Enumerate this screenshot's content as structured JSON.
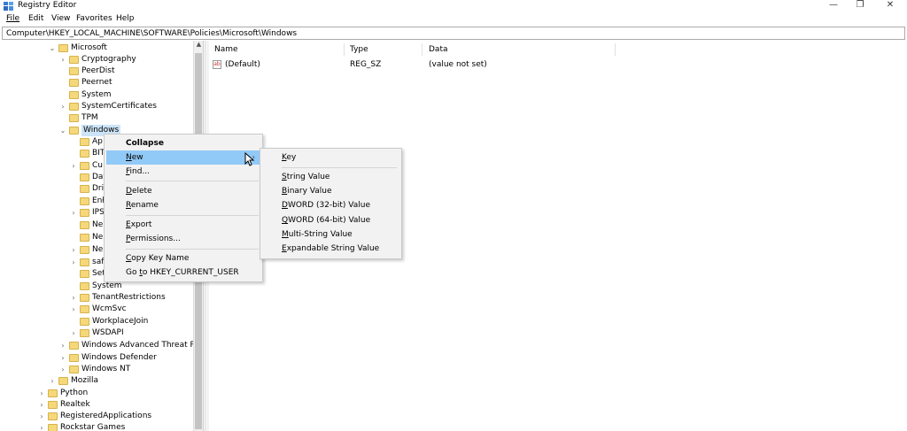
{
  "window": {
    "title": "Registry Editor",
    "minimize": "—",
    "restore": "❐",
    "close": "✕"
  },
  "menu": {
    "file": "File",
    "edit": "Edit",
    "view": "View",
    "favorites": "Favorites",
    "help": "Help"
  },
  "address": "Computer\\HKEY_LOCAL_MACHINE\\SOFTWARE\\Policies\\Microsoft\\Windows",
  "tree": {
    "microsoft": "Microsoft",
    "cryptography": "Cryptography",
    "peerdist": "PeerDist",
    "peernet": "Peernet",
    "system": "System",
    "systemcertificates": "SystemCertificates",
    "tpm": "TPM",
    "windows": "Windows",
    "ap": "Ap",
    "bit": "BIT",
    "cu": "Cu",
    "dat": "Dat",
    "dri": "Dri",
    "enh": "Enł",
    "ips": "IPS",
    "ne1": "Ne",
    "ne2": "Ne",
    "ne3": "Ne",
    "saf": "saf",
    "set": "Set",
    "system2": "System",
    "tenantrestrictions": "TenantRestrictions",
    "wcmsvc": "WcmSvc",
    "workplacejoin": "WorkplaceJoin",
    "wsdapi": "WSDAPI",
    "windows_atp": "Windows Advanced Threat Prot",
    "windows_defender": "Windows Defender",
    "windows_nt": "Windows NT",
    "mozilla": "Mozilla",
    "python": "Python",
    "realtek": "Realtek",
    "registeredapplications": "RegisteredApplications",
    "rockstar": "Rockstar Games"
  },
  "values": {
    "headers": {
      "name": "Name",
      "type": "Type",
      "data": "Data"
    },
    "rows": [
      {
        "name": "(Default)",
        "type": "REG_SZ",
        "data": "(value not set)"
      }
    ]
  },
  "context_menu": {
    "collapse": "Collapse",
    "new_prefix": "",
    "new_u": "N",
    "new_rest": "ew",
    "find_u": "F",
    "find_rest": "ind...",
    "delete_u": "D",
    "delete_rest": "elete",
    "rename_u": "R",
    "rename_rest": "ename",
    "export_u": "E",
    "export_rest": "xport",
    "permissions_u": "P",
    "permissions_rest": "ermissions...",
    "copykey_prefix": "",
    "copykey_u": "C",
    "copykey_rest": "opy Key Name",
    "goto_pre": "Go ",
    "goto_u": "t",
    "goto_rest": "o HKEY_CURRENT_USER"
  },
  "submenu": {
    "key_u": "K",
    "key_rest": "ey",
    "string_u": "S",
    "string_rest": "tring Value",
    "binary_u": "B",
    "binary_rest": "inary Value",
    "dword_u": "D",
    "dword_rest": "WORD (32-bit) Value",
    "qword_u": "Q",
    "qword_rest": "WORD (64-bit) Value",
    "multi_u": "M",
    "multi_rest": "ulti-String Value",
    "expand_u": "E",
    "expand_rest": "xpandable String Value"
  },
  "colors": {
    "folder": "#f5d87a",
    "highlight": "#91c9f7",
    "selected": "#cce4f7"
  }
}
